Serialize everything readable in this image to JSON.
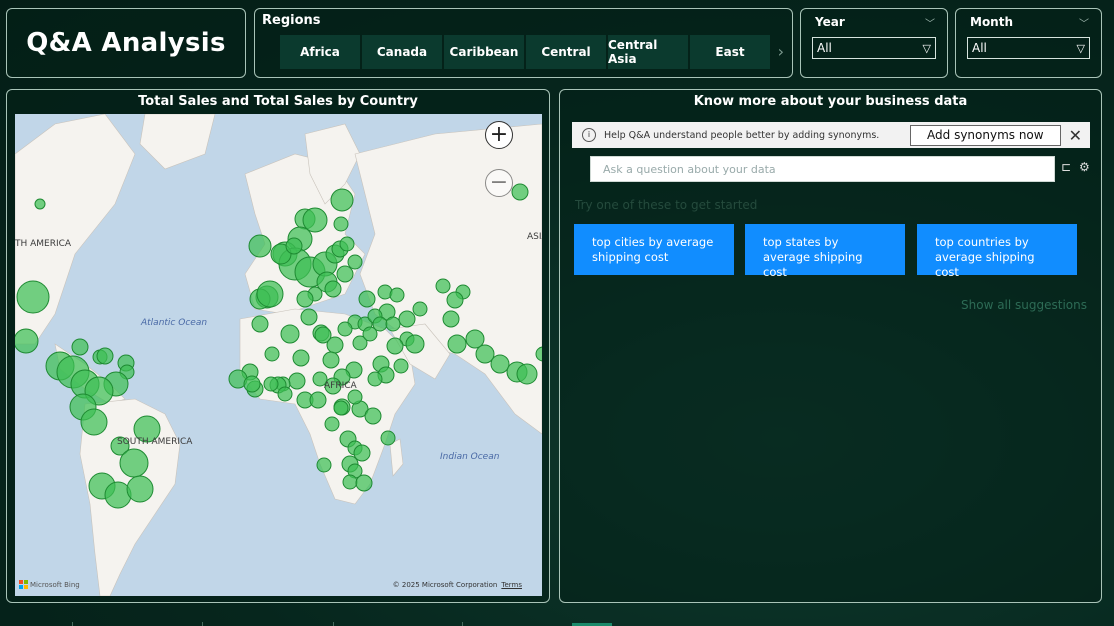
{
  "title": "Q&A Analysis",
  "regions": {
    "label": "Regions",
    "items": [
      "Africa",
      "Canada",
      "Caribbean",
      "Central",
      "Central Asia",
      "East"
    ]
  },
  "year": {
    "label": "Year",
    "value": "All"
  },
  "month": {
    "label": "Month",
    "value": "All"
  },
  "map": {
    "title": "Total Sales and Total Sales by Country",
    "labels": {
      "north_america": "TH AMERICA",
      "south_america": "SOUTH AMERICA",
      "africa": "AFRICA",
      "asia": "ASIA"
    },
    "oceans": {
      "atlantic": "Atlantic Ocean",
      "indian": "Indian Ocean"
    },
    "attribution": "Microsoft Bing",
    "copyright": "© 2025 Microsoft Corporation",
    "terms": "Terms",
    "colors": {
      "water": "#c1d6e8",
      "land": "#f5f3ef",
      "bubble": "#3fbf55",
      "bubble_stroke": "#1e8a32"
    }
  },
  "qa": {
    "title": "Know more about your business data",
    "notice": "Help Q&A understand people better by adding synonyms.",
    "add_button": "Add synonyms now",
    "placeholder": "Ask a question about your data",
    "hint": "Try one of these to get started",
    "suggestions": [
      "top cities by average shipping cost",
      "top states by average shipping cost",
      "top countries by average shipping cost"
    ],
    "show_all": "Show all suggestions",
    "accent": "#118dff"
  }
}
